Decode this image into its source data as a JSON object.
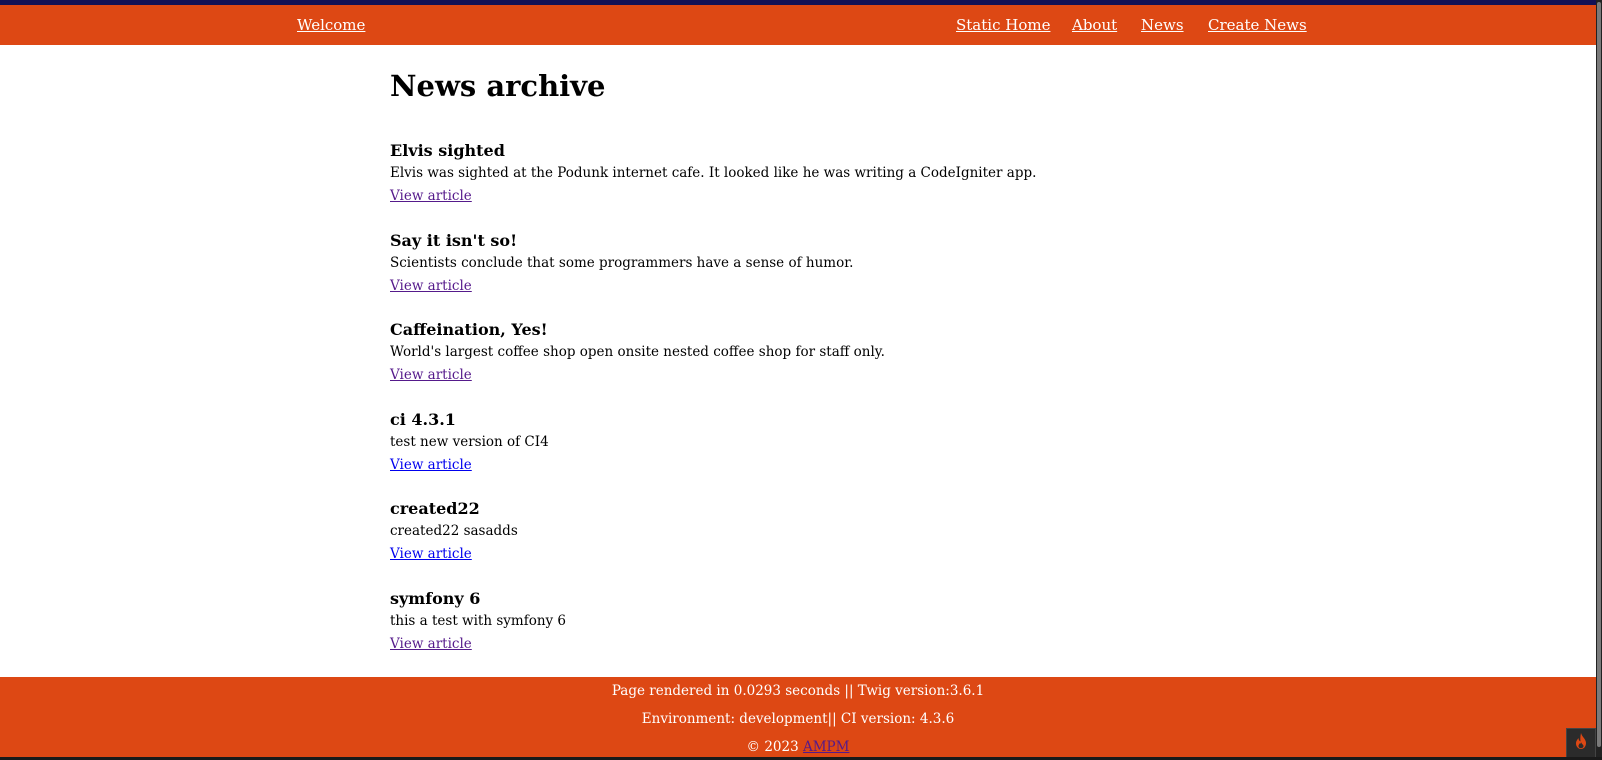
{
  "nav": {
    "welcome": "Welcome",
    "static_home": "Static Home",
    "about": "About",
    "news": "News",
    "create_news": "Create News"
  },
  "page": {
    "title": "News archive"
  },
  "articles": [
    {
      "title": "Elvis sighted",
      "text": "Elvis was sighted at the Podunk internet cafe. It looked like he was writing a CodeIgniter app.",
      "link": "View article",
      "visited": true
    },
    {
      "title": "Say it isn't so!",
      "text": "Scientists conclude that some programmers have a sense of humor.",
      "link": "View article",
      "visited": true
    },
    {
      "title": "Caffeination, Yes!",
      "text": "World's largest coffee shop open onsite nested coffee shop for staff only.",
      "link": "View article",
      "visited": true
    },
    {
      "title": "ci 4.3.1",
      "text": "test new version of CI4",
      "link": "View article",
      "visited": false
    },
    {
      "title": "created22",
      "text": "created22 sasadds",
      "link": "View article",
      "visited": false
    },
    {
      "title": "symfony 6",
      "text": "this a test with symfony 6",
      "link": "View article",
      "visited": true
    }
  ],
  "footer": {
    "render_info": "Page rendered in 0.0293 seconds || Twig version:3.6.1",
    "env_info": "Environment: development|| CI version: 4.3.6",
    "copyright": "© 2023",
    "brand_link": "AMPM"
  },
  "colors": {
    "header_bg": "#dd4814",
    "top_strip": "#131155",
    "link_visited": "#551a8b",
    "link_unvisited": "#0000ee"
  },
  "icons": {
    "debug_toolbar": "flame-icon"
  }
}
